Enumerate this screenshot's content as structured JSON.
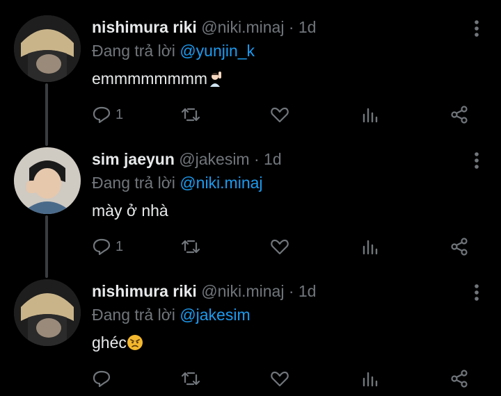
{
  "reply_prefix": "Đang trả lời",
  "tweets": [
    {
      "name": "nishimura riki",
      "handle": "@niki.minaj",
      "dot": "·",
      "time": "1d",
      "reply_to": "@yunjin_k",
      "text": "emmmmmmmm",
      "emoji": "person-raising-hand",
      "reply_count": "1"
    },
    {
      "name": "sim jaeyun",
      "handle": "@jakesim",
      "dot": "·",
      "time": "1d",
      "reply_to": "@niki.minaj",
      "text": "mày ở nhà",
      "emoji": "",
      "reply_count": "1"
    },
    {
      "name": "nishimura riki",
      "handle": "@niki.minaj",
      "dot": "·",
      "time": "1d",
      "reply_to": "@jakesim",
      "text": "ghéc",
      "emoji": "angry-face",
      "reply_count": ""
    }
  ],
  "icons": {
    "reply": "reply-icon",
    "retweet": "retweet-icon",
    "like": "like-icon",
    "views": "views-icon",
    "share": "share-icon",
    "more": "more-options-icon"
  },
  "colors": {
    "background": "#000000",
    "text": "#e7e9ea",
    "muted": "#71767b",
    "mention": "#1d9bf0",
    "thread_line": "#3a3d40"
  }
}
